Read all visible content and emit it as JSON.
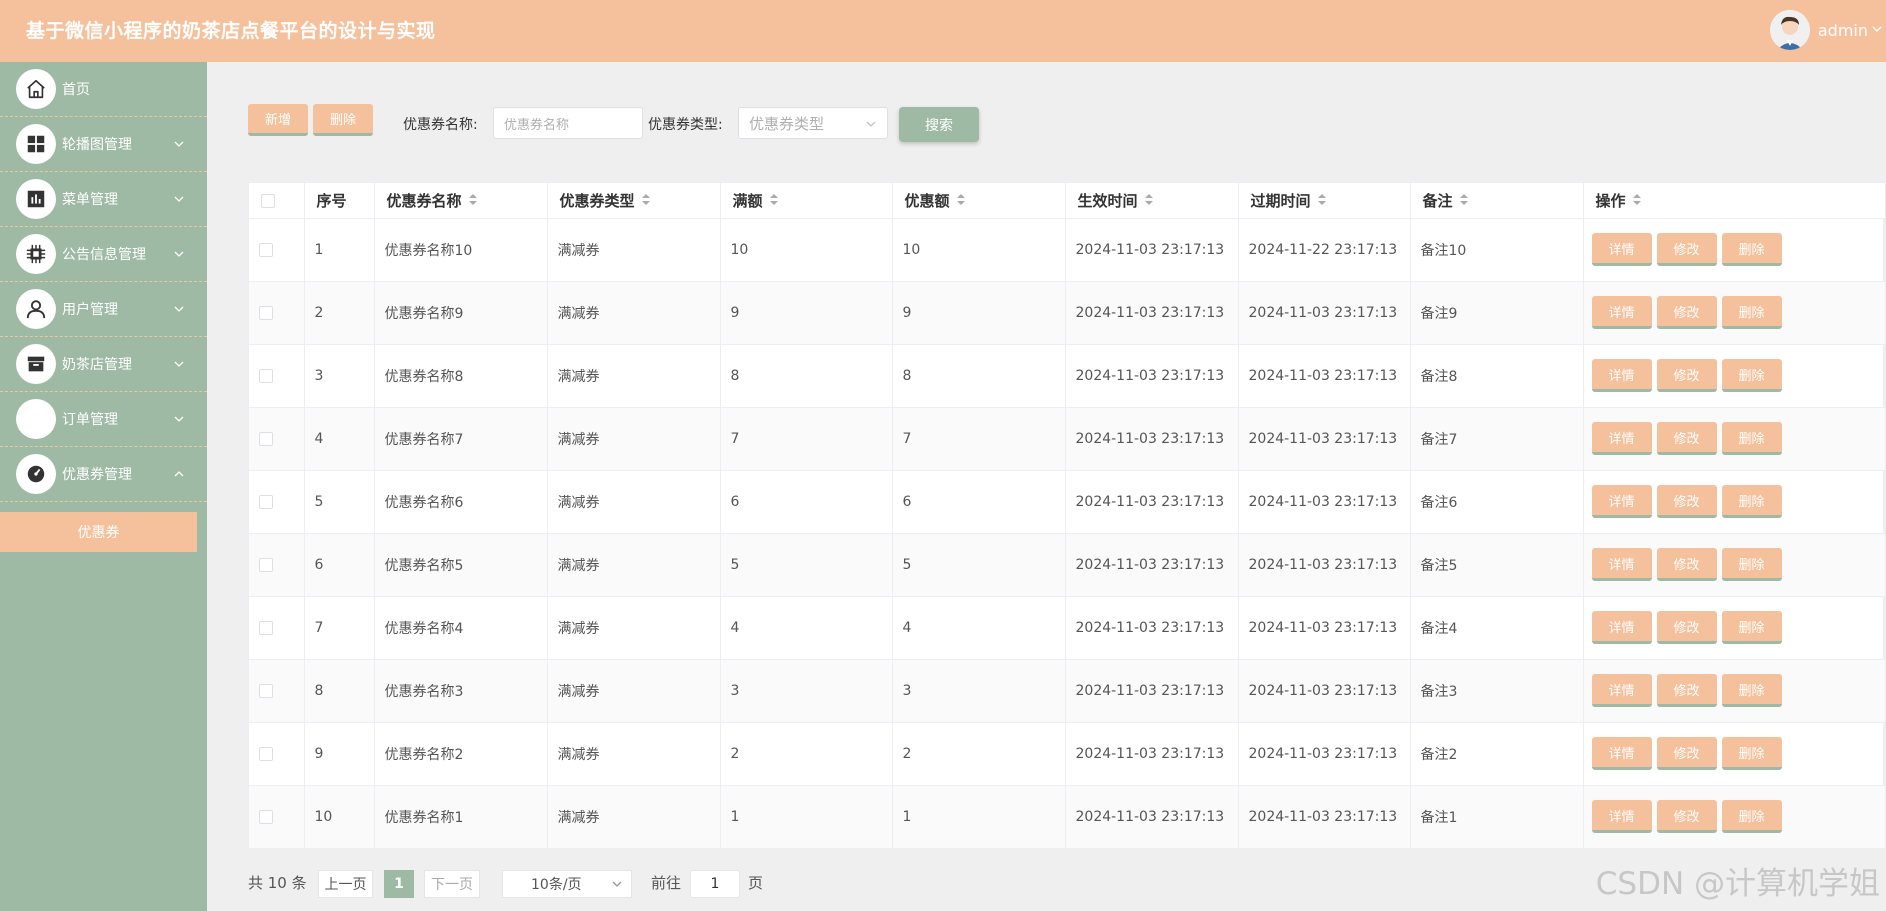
{
  "header": {
    "title": "基于微信小程序的奶茶店点餐平台的设计与实现",
    "username": "admin"
  },
  "sidebar": {
    "items": [
      {
        "label": "首页",
        "icon": "home-icon",
        "has_arrow": false
      },
      {
        "label": "轮播图管理",
        "icon": "grid-icon",
        "has_arrow": true
      },
      {
        "label": "菜单管理",
        "icon": "chart-icon",
        "has_arrow": true
      },
      {
        "label": "公告信息管理",
        "icon": "chip-icon",
        "has_arrow": true
      },
      {
        "label": "用户管理",
        "icon": "user-icon",
        "has_arrow": true
      },
      {
        "label": "奶茶店管理",
        "icon": "box-icon",
        "has_arrow": true
      },
      {
        "label": "订单管理",
        "icon": "blank-icon",
        "has_arrow": true
      },
      {
        "label": "优惠券管理",
        "icon": "gauge-icon",
        "has_arrow": true,
        "expanded": true
      }
    ],
    "submenu": {
      "label": "优惠券"
    }
  },
  "toolbar": {
    "add_label": "新增",
    "delete_label": "删除",
    "name_label": "优惠券名称:",
    "name_placeholder": "优惠券名称",
    "type_label": "优惠券类型:",
    "type_placeholder": "优惠券类型",
    "search_label": "搜索"
  },
  "table": {
    "headers": [
      "序号",
      "优惠券名称",
      "优惠券类型",
      "满额",
      "优惠额",
      "生效时间",
      "过期时间",
      "备注",
      "操作"
    ],
    "action_labels": {
      "detail": "详情",
      "edit": "修改",
      "delete": "删除"
    },
    "rows": [
      {
        "index": "1",
        "name": "优惠券名称10",
        "type": "满减券",
        "full": "10",
        "discount": "10",
        "start": "2024-11-03 23:17:13",
        "end": "2024-11-22 23:17:13",
        "note": "备注10"
      },
      {
        "index": "2",
        "name": "优惠券名称9",
        "type": "满减券",
        "full": "9",
        "discount": "9",
        "start": "2024-11-03 23:17:13",
        "end": "2024-11-03 23:17:13",
        "note": "备注9"
      },
      {
        "index": "3",
        "name": "优惠券名称8",
        "type": "满减券",
        "full": "8",
        "discount": "8",
        "start": "2024-11-03 23:17:13",
        "end": "2024-11-03 23:17:13",
        "note": "备注8"
      },
      {
        "index": "4",
        "name": "优惠券名称7",
        "type": "满减券",
        "full": "7",
        "discount": "7",
        "start": "2024-11-03 23:17:13",
        "end": "2024-11-03 23:17:13",
        "note": "备注7"
      },
      {
        "index": "5",
        "name": "优惠券名称6",
        "type": "满减券",
        "full": "6",
        "discount": "6",
        "start": "2024-11-03 23:17:13",
        "end": "2024-11-03 23:17:13",
        "note": "备注6"
      },
      {
        "index": "6",
        "name": "优惠券名称5",
        "type": "满减券",
        "full": "5",
        "discount": "5",
        "start": "2024-11-03 23:17:13",
        "end": "2024-11-03 23:17:13",
        "note": "备注5"
      },
      {
        "index": "7",
        "name": "优惠券名称4",
        "type": "满减券",
        "full": "4",
        "discount": "4",
        "start": "2024-11-03 23:17:13",
        "end": "2024-11-03 23:17:13",
        "note": "备注4"
      },
      {
        "index": "8",
        "name": "优惠券名称3",
        "type": "满减券",
        "full": "3",
        "discount": "3",
        "start": "2024-11-03 23:17:13",
        "end": "2024-11-03 23:17:13",
        "note": "备注3"
      },
      {
        "index": "9",
        "name": "优惠券名称2",
        "type": "满减券",
        "full": "2",
        "discount": "2",
        "start": "2024-11-03 23:17:13",
        "end": "2024-11-03 23:17:13",
        "note": "备注2"
      },
      {
        "index": "10",
        "name": "优惠券名称1",
        "type": "满减券",
        "full": "1",
        "discount": "1",
        "start": "2024-11-03 23:17:13",
        "end": "2024-11-03 23:17:13",
        "note": "备注1"
      }
    ]
  },
  "pagination": {
    "total": "共 10 条",
    "prev": "上一页",
    "current": "1",
    "next": "下一页",
    "page_size": "10条/页",
    "goto_label": "前往",
    "goto_value": "1",
    "page_suffix": "页"
  },
  "watermark": "CSDN @计算机学姐",
  "colors": {
    "accent": "#f4c19c",
    "sidebar": "#9ebaa5"
  }
}
